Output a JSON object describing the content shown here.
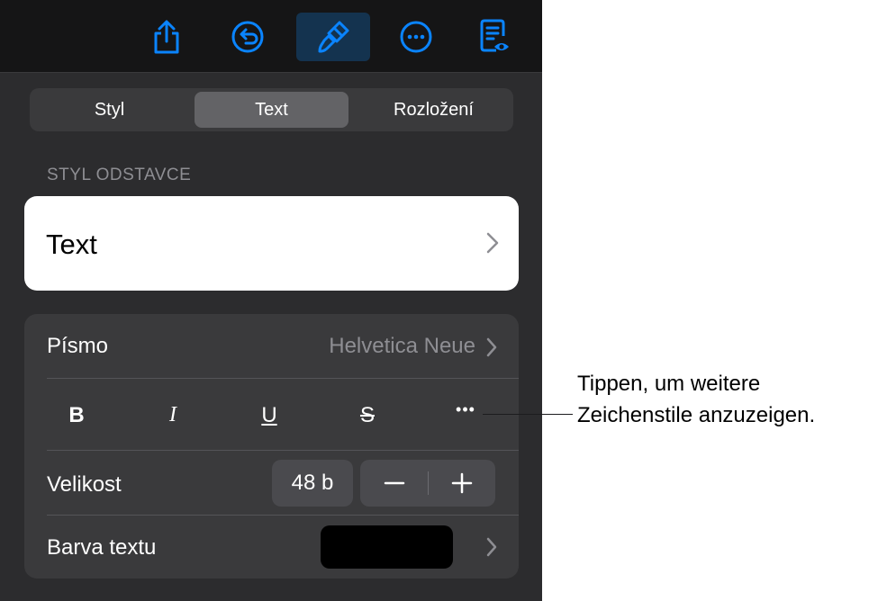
{
  "tabs": [
    {
      "label": "Styl",
      "selected": false
    },
    {
      "label": "Text",
      "selected": true
    },
    {
      "label": "Rozložení",
      "selected": false
    }
  ],
  "paragraph_style": {
    "section_label": "STYL ODSTAVCE",
    "current_style": "Text"
  },
  "font": {
    "label": "Písmo",
    "value": "Helvetica Neue"
  },
  "format_buttons": {
    "bold": "B",
    "italic": "I",
    "underline": "U",
    "strikethrough": "S",
    "more": "•••"
  },
  "size": {
    "label": "Velikost",
    "value": "48 b"
  },
  "text_color": {
    "label": "Barva textu",
    "swatch_color": "#000000"
  },
  "callout": {
    "line1": "Tippen, um weitere",
    "line2": "Zeichenstile anzuzeigen."
  },
  "colors": {
    "accent": "#0a84ff",
    "panel_bg": "#2c2c2e",
    "toolbar_bg": "#151516",
    "active_tool_bg": "#14334f"
  },
  "toolbar_icons": [
    "share-icon",
    "undo-icon",
    "paintbrush-icon",
    "more-icon",
    "document-view-icon"
  ]
}
